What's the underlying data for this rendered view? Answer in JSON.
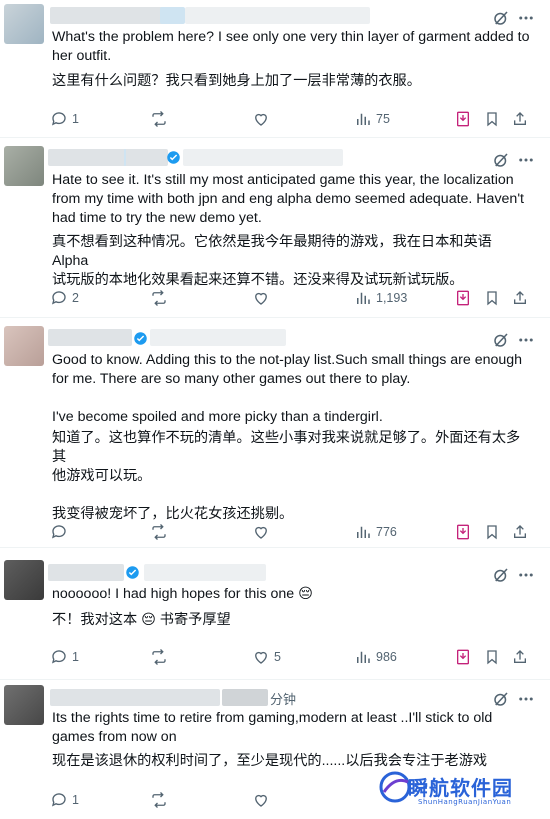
{
  "posts": [
    {
      "text_en": "What's the problem here? I see only one very thin layer of garment added to\nher outfit.",
      "text_zh": "这里有什么问题？我只看到她身上加了一层非常薄的衣服。",
      "replies": "1",
      "reposts": "",
      "likes": "",
      "views": "75"
    },
    {
      "text_en": "Hate to see it. It's still my most anticipated game this year, the localization\nfrom my time with both jpn and eng alpha demo seemed adequate. Haven't\nhad time to try the new demo yet.",
      "text_zh": "真不想看到这种情况。它依然是我今年最期待的游戏，我在日本和英语 Alpha\n试玩版的本地化效果看起来还算不错。还没来得及试玩新试玩版。",
      "replies": "2",
      "reposts": "",
      "likes": "",
      "views": "1,193"
    },
    {
      "text_en": "Good to know. Adding this to the not-play list.Such small things are enough\nfor me. There are so many other games out there to play.\n\nI've become spoiled and more picky than a tindergirl.",
      "text_zh": "知道了。这也算作不玩的清单。这些小事对我来说就足够了。外面还有太多其\n他游戏可以玩。\n\n我变得被宠坏了，比火花女孩还挑剔。",
      "replies": "",
      "reposts": "",
      "likes": "",
      "views": "776"
    },
    {
      "text_en": "noooooo! I had high hopes for this one 😔",
      "text_zh": "不！我对这本 😔 书寄予厚望",
      "replies": "1",
      "reposts": "",
      "likes": "5",
      "views": "986"
    },
    {
      "timestamp": "分钟",
      "text_en": "Its the rights time to retire from gaming,modern at least ..I'll stick to old\ngames from now on",
      "text_zh": "现在是该退休的权利时间了，至少是现代的......以后我会专注于老游戏",
      "replies": "1",
      "reposts": "",
      "likes": "",
      "views": ""
    }
  ],
  "watermark": {
    "title": "瞬航软件园",
    "subtitle": "ShunHangRuanJianYuan"
  },
  "colors": {
    "text": "#0f1419",
    "muted": "#536471",
    "verified": "#1d9bf0",
    "bookmark_pink": "#c4227a",
    "divider": "#eff3f4"
  }
}
